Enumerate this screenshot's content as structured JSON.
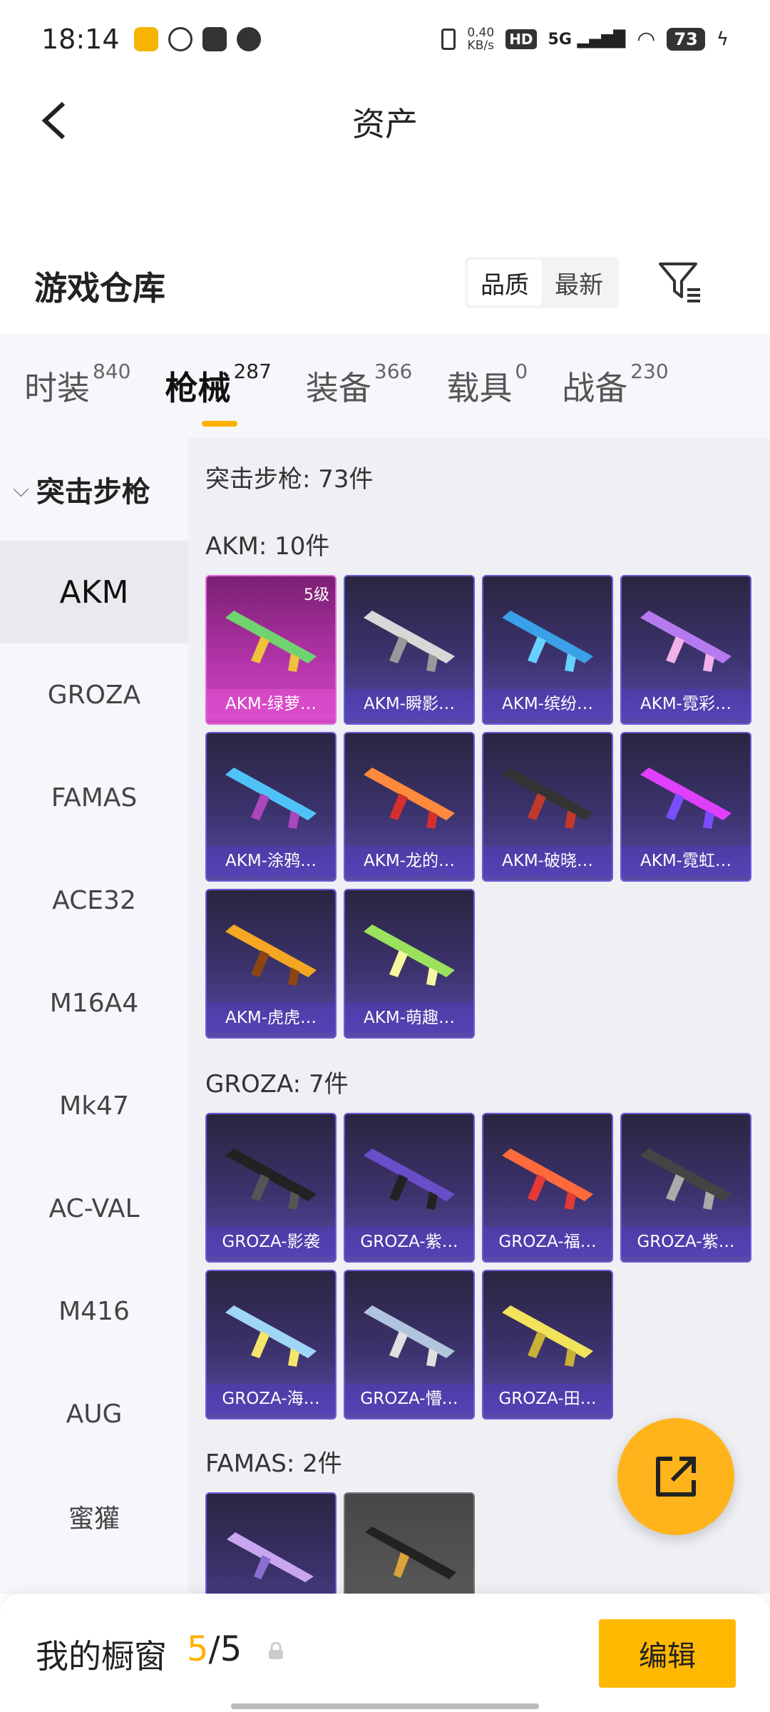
{
  "status": {
    "time": "18:14",
    "net_speed": "0.40",
    "net_unit": "KB/s",
    "hd": "HD",
    "signal": "5G",
    "battery": "73"
  },
  "header": {
    "title": "资产"
  },
  "warehouse": {
    "title": "游戏仓库",
    "sort_quality": "品质",
    "sort_newest": "最新"
  },
  "tabs": [
    {
      "label": "时装",
      "count": "840"
    },
    {
      "label": "枪械",
      "count": "287"
    },
    {
      "label": "装备",
      "count": "366"
    },
    {
      "label": "载具",
      "count": "0"
    },
    {
      "label": "战备",
      "count": "230"
    }
  ],
  "sidebar": {
    "category": "突击步枪",
    "items": [
      "AKM",
      "GROZA",
      "FAMAS",
      "ACE32",
      "M16A4",
      "Mk47",
      "AC-VAL",
      "M416",
      "AUG",
      "蜜獾"
    ]
  },
  "content": {
    "summary": "突击步枪: 73件",
    "sections": [
      {
        "title": "AKM: 10件",
        "items": [
          {
            "name": "AKM-绿萝…",
            "level": "5级"
          },
          {
            "name": "AKM-瞬影…"
          },
          {
            "name": "AKM-缤纷…"
          },
          {
            "name": "AKM-霓彩…"
          },
          {
            "name": "AKM-涂鸦…"
          },
          {
            "name": "AKM-龙的…"
          },
          {
            "name": "AKM-破晓…"
          },
          {
            "name": "AKM-霓虹…"
          },
          {
            "name": "AKM-虎虎…"
          },
          {
            "name": "AKM-萌趣…"
          }
        ]
      },
      {
        "title": "GROZA: 7件",
        "items": [
          {
            "name": "GROZA-影袭"
          },
          {
            "name": "GROZA-紫…"
          },
          {
            "name": "GROZA-福…"
          },
          {
            "name": "GROZA-紫…"
          },
          {
            "name": "GROZA-海…"
          },
          {
            "name": "GROZA-懵…"
          },
          {
            "name": "GROZA-田…"
          }
        ]
      },
      {
        "title": "FAMAS: 2件",
        "items": []
      }
    ]
  },
  "bottom": {
    "showcase_label": "我的橱窗",
    "count_current": "5",
    "count_total": "/5",
    "edit_label": "编辑"
  },
  "colors": {
    "accent": "#ffb000",
    "card_purple": "#3c336e",
    "card_pink": "#b033a6"
  }
}
